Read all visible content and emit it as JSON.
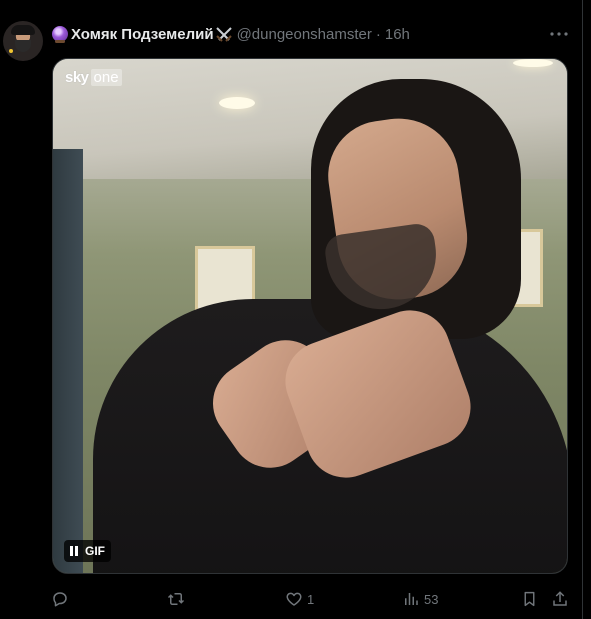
{
  "tweet": {
    "author_name": "Хомяк Подземелий",
    "handle": "@dungeonshamster",
    "separator": "·",
    "time": "16h",
    "media": {
      "watermark_sky": "sky",
      "watermark_one": "one",
      "gif_label": "GIF"
    },
    "actions": {
      "reply_count": "",
      "retweet_count": "",
      "like_count": "1",
      "views_count": "53"
    }
  },
  "colors": {
    "background": "#000000",
    "text_primary": "#e7e9ea",
    "text_secondary": "#71767b",
    "border": "#2f3336"
  },
  "icons": {
    "avatar": "avatar",
    "name_emoji_1": "crystal-ball-icon",
    "name_emoji_2": "crossed-swords-icon",
    "more": "more-icon",
    "pause": "pause-icon",
    "reply": "reply-icon",
    "retweet": "retweet-icon",
    "like": "heart-icon",
    "views": "views-icon",
    "bookmark": "bookmark-icon",
    "share": "share-icon"
  }
}
